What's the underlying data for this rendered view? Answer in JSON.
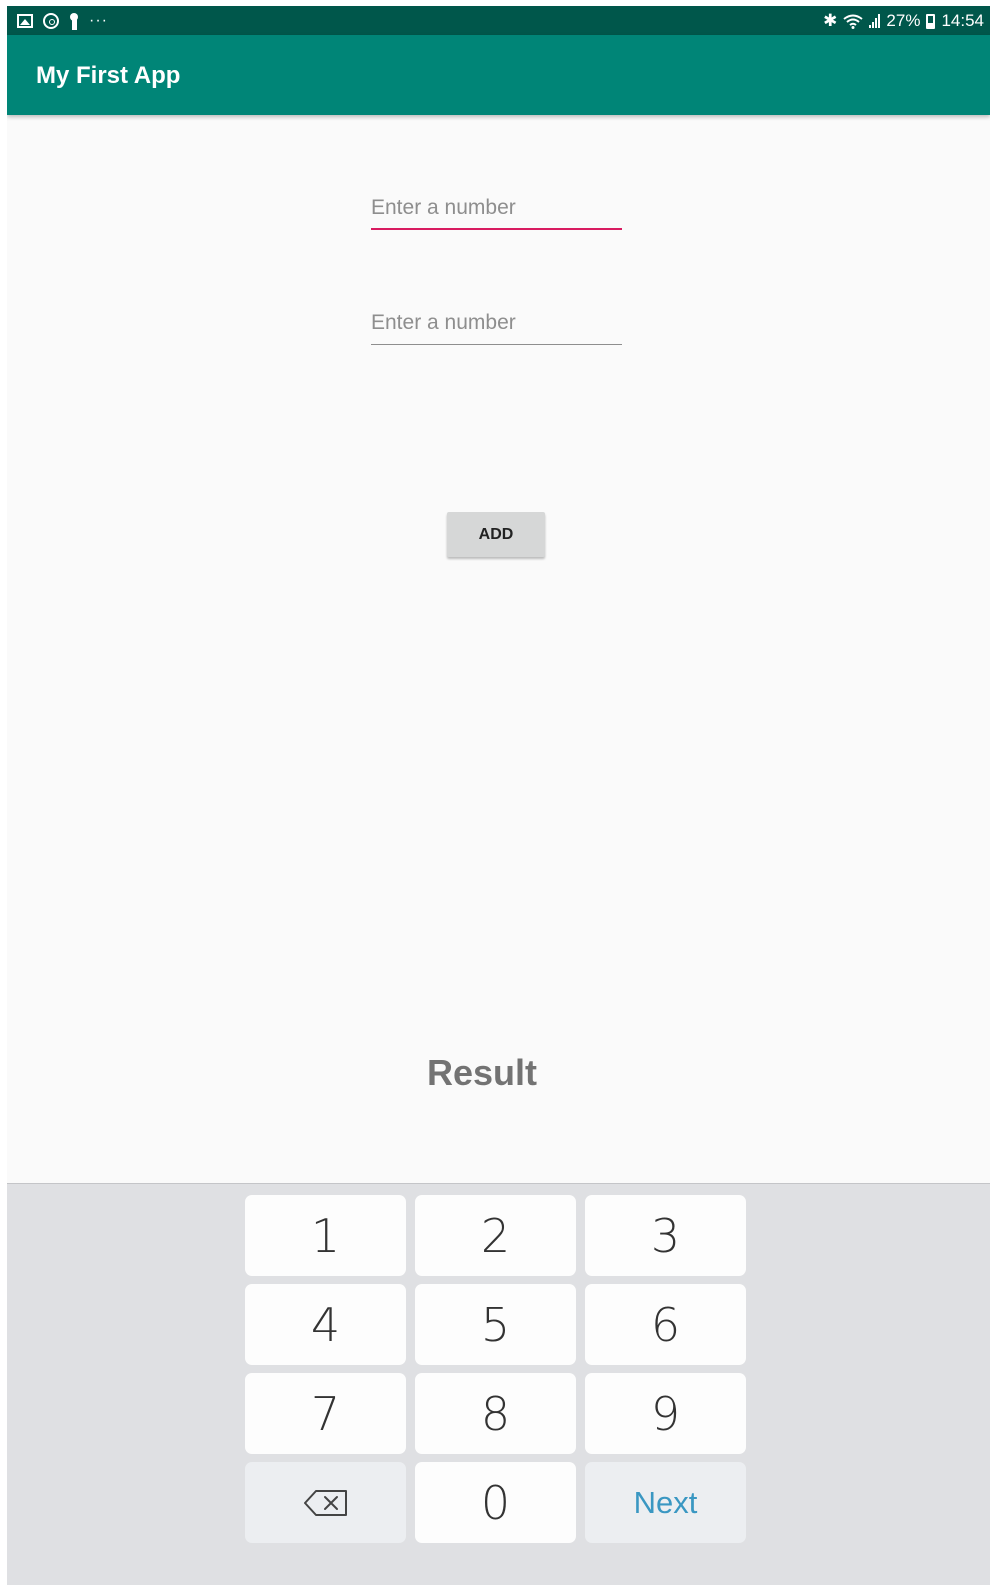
{
  "status_bar": {
    "battery_percent": "27%",
    "time": "14:54",
    "overflow": "···",
    "icons": [
      "gallery-icon",
      "sync-icon",
      "keyhole-icon",
      "bluetooth-icon",
      "wifi-icon",
      "signal-icon",
      "battery-icon"
    ]
  },
  "app_bar": {
    "title": "My First App",
    "color": "#008577",
    "status_color": "#00574b"
  },
  "form": {
    "first_number": {
      "value": "",
      "placeholder": "Enter a number",
      "focused": true
    },
    "second_number": {
      "value": "",
      "placeholder": "Enter a number",
      "focused": false
    },
    "add_button_label": "ADD",
    "result_label": "Result",
    "accent_color": "#d81b60"
  },
  "keyboard": {
    "keys": [
      "1",
      "2",
      "3",
      "4",
      "5",
      "6",
      "7",
      "8",
      "9",
      "0"
    ],
    "backspace_icon": "backspace-icon",
    "action_label": "Next"
  }
}
